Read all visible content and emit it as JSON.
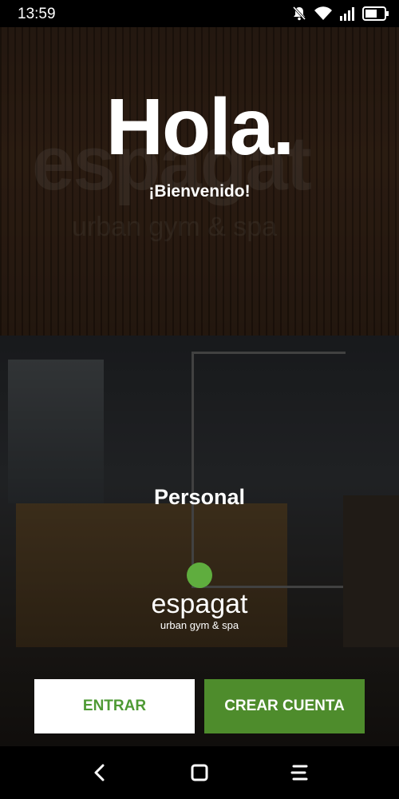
{
  "status_bar": {
    "time": "13:59"
  },
  "hero": {
    "title": "Hola.",
    "subtitle": "¡Bienvenido!"
  },
  "role": "Personal",
  "brand": {
    "name": "espagat",
    "tagline": "urban gym & spa",
    "accent_color": "#5fad3e"
  },
  "actions": {
    "login_label": "ENTRAR",
    "signup_label": "CREAR CUENTA"
  },
  "nav": {
    "back": "back-icon",
    "home": "home-icon",
    "menu": "menu-icon"
  }
}
